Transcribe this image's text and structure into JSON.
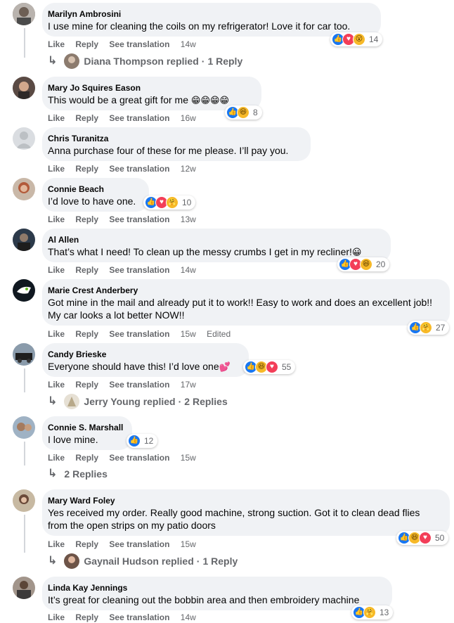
{
  "actions": {
    "like": "Like",
    "reply": "Reply",
    "translate": "See translation"
  },
  "comments": [
    {
      "author": "Marilyn Ambrosini",
      "text": "I use mine for cleaning the coils on my refrigerator! Love it for car too.",
      "time": "14w",
      "reaction_count": "14",
      "reply_author": "Diana Thompson replied",
      "reply_count": "1 Reply"
    },
    {
      "author": "Mary Jo Squires Eason",
      "text": "This would be a great gift for me",
      "emoji": "😁😁😁😁",
      "time": "16w",
      "reaction_count": "8"
    },
    {
      "author": "Chris Turanitza",
      "text": "Anna purchase four of these for me please. I’ll pay you.",
      "time": "12w"
    },
    {
      "author": "Connie Beach",
      "text": "I’d love to have one.",
      "time": "13w",
      "reaction_count": "10"
    },
    {
      "author": "Al Allen",
      "text": "That’s what I need! To clean up the messy crumbs I get in my recliner!",
      "emoji": "😀",
      "time": "14w",
      "reaction_count": "20"
    },
    {
      "author": "Marie Crest Anderbery",
      "text": "Got mine in the mail and already put it to work!! Easy to work and does an excellent job!! My car looks a lot better NOW!!",
      "time": "15w",
      "edited": "Edited",
      "reaction_count": "27"
    },
    {
      "author": "Candy Brieske",
      "text": "Everyone should have this! I’d love one",
      "emoji": "💕",
      "time": "17w",
      "reaction_count": "55",
      "reply_author": "Jerry Young replied",
      "reply_count": "2 Replies"
    },
    {
      "author": "Connie S. Marshall",
      "text": "I love mine.",
      "time": "15w",
      "reaction_count": "12",
      "replies_label": "2 Replies"
    },
    {
      "author": "Mary Ward Foley",
      "text": "Yes received my order. Really good machine, strong suction. Got it to clean dead flies from the open strips on my patio doors",
      "time": "15w",
      "reaction_count": "50",
      "reply_author": "Gaynail Hudson replied",
      "reply_count": "1 Reply"
    },
    {
      "author": "Linda Kay Jennings",
      "text": "It’s great for cleaning out the bobbin area and then embroidery machine",
      "time": "14w",
      "reaction_count": "13"
    }
  ],
  "reply_separator": "·",
  "reaction_icons": {
    "like": "👍",
    "love": "♥",
    "haha": "😆",
    "wow": "😮",
    "care": "🤗"
  },
  "colors": {
    "bubble": "#f0f2f5",
    "meta": "#65676b",
    "like": "#1877f2",
    "love": "#f33e58"
  }
}
